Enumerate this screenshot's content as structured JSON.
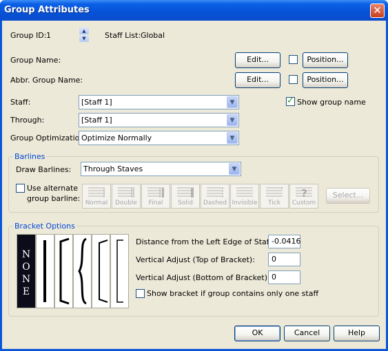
{
  "window": {
    "title": "Group Attributes",
    "close": "✕"
  },
  "group_id": {
    "label": "Group ID:",
    "value": "1"
  },
  "staff_list": {
    "label": "Staff List:",
    "value": "Global"
  },
  "group_name": {
    "label": "Group Name:",
    "edit": "Edit...",
    "position": "Position..."
  },
  "abbr_group_name": {
    "label": "Abbr. Group Name:",
    "edit": "Edit...",
    "position": "Position..."
  },
  "staff": {
    "label": "Staff:",
    "value": "[Staff 1]"
  },
  "through": {
    "label": "Through:",
    "value": "[Staff 1]"
  },
  "group_optimization": {
    "label": "Group Optimization:",
    "value": "Optimize Normally"
  },
  "show_group_name": {
    "label": "Show group name",
    "checked": true
  },
  "barlines": {
    "legend": "Barlines",
    "draw_label": "Draw Barlines:",
    "draw_value": "Through Staves",
    "use_alternate_line1": "Use alternate",
    "use_alternate_line2": "group barline:",
    "styles": [
      "Normal",
      "Double",
      "Final",
      "Solid",
      "Dashed",
      "Invisible",
      "Tick",
      "Custom"
    ],
    "select": "Select..."
  },
  "bracket": {
    "legend": "Bracket Options",
    "none_letters": [
      "N",
      "O",
      "N",
      "E"
    ],
    "distance_label": "Distance from the Left Edge of Staff:",
    "distance_value": "-0.0416",
    "vtop_label": "Vertical Adjust (Top of Bracket):",
    "vtop_value": "0",
    "vbottom_label": "Vertical Adjust (Bottom of Bracket):",
    "vbottom_value": "0",
    "show_one_staff": "Show bracket if group contains only one staff"
  },
  "buttons": {
    "ok": "OK",
    "cancel": "Cancel",
    "help": "Help"
  }
}
